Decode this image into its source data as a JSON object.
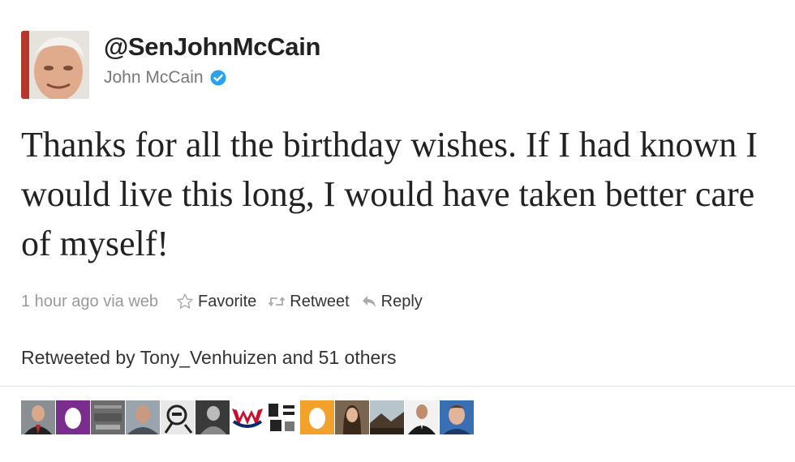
{
  "profile": {
    "handle": "@SenJohnMcCain",
    "display_name": "John McCain",
    "verified_icon": "verified-badge-icon",
    "verified_color": "#2aa3ef"
  },
  "tweet": {
    "text": "Thanks for all the birthday wishes. If I had known I would live this long, I would have taken better care of myself!"
  },
  "meta": {
    "time": "1 hour ago via web",
    "favorite_label": "Favorite",
    "retweet_label": "Retweet",
    "reply_label": "Reply"
  },
  "retweeted_by": "Retweeted by Tony_Venhuizen and 51 others",
  "retweeter_avatars": [
    {
      "name": "avatar-man-suit",
      "icon": "person"
    },
    {
      "name": "avatar-egg-purple",
      "icon": "egg"
    },
    {
      "name": "avatar-gray-texture",
      "icon": "texture"
    },
    {
      "name": "avatar-man-portrait",
      "icon": "person"
    },
    {
      "name": "avatar-bw-cartoon",
      "icon": "sketch"
    },
    {
      "name": "avatar-bw-photo",
      "icon": "photo"
    },
    {
      "name": "avatar-capitals-logo",
      "icon": "logo"
    },
    {
      "name": "avatar-typography",
      "icon": "text"
    },
    {
      "name": "avatar-egg-orange",
      "icon": "egg"
    },
    {
      "name": "avatar-woman",
      "icon": "person"
    },
    {
      "name": "avatar-landscape",
      "icon": "landscape"
    },
    {
      "name": "avatar-man-dark-suit",
      "icon": "person"
    },
    {
      "name": "avatar-man-smiling",
      "icon": "person"
    }
  ]
}
